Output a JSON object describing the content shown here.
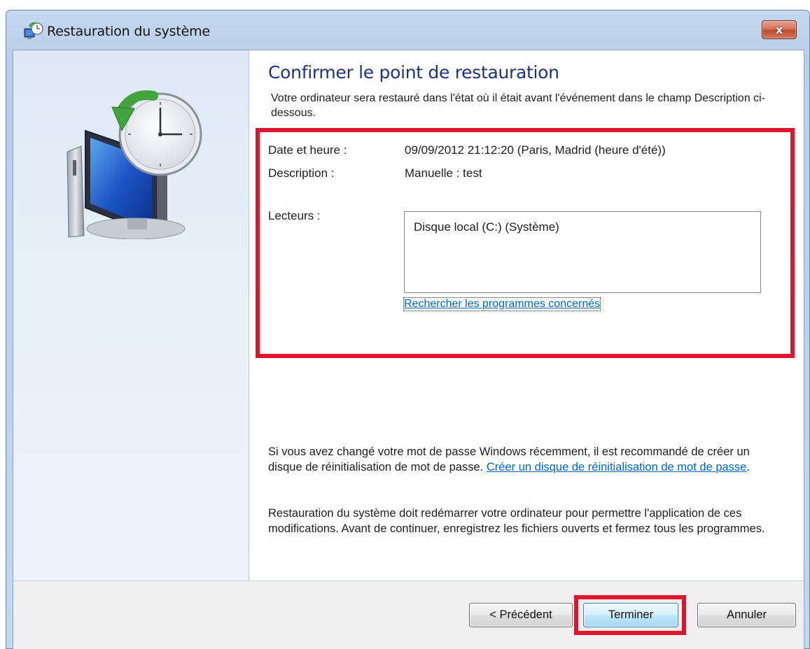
{
  "window": {
    "title": "Restauration du système",
    "close_label": "x"
  },
  "main": {
    "heading": "Confirmer le point de restauration",
    "intro": "Votre ordinateur sera restauré dans l'état où il était avant l'événement dans le champ Description ci-dessous.",
    "date_label": "Date et heure :",
    "date_value": "09/09/2012 21:12:20 (Paris, Madrid (heure d'été))",
    "description_label": "Description :",
    "description_value": "Manuelle : test",
    "drives_label": "Lecteurs :",
    "drives": [
      "Disque local (C:) (Système)"
    ],
    "scan_link": "Rechercher les programmes concernés",
    "password_text": "Si vous avez changé votre mot de passe Windows récemment, il est recommandé de créer un disque de réinitialisation de mot de passe.",
    "password_link": "Créer un disque de réinitialisation de mot de passe",
    "password_end": ".",
    "restart_text": "Restauration du système doit redémarrer votre ordinateur pour permettre l'application de ces modifications. Avant de continuer, enregistrez les fichiers ouverts et fermez tous les programmes."
  },
  "footer": {
    "back_label": "< Précédent",
    "finish_label": "Terminer",
    "cancel_label": "Annuler"
  },
  "colors": {
    "highlight": "#e0152b",
    "heading": "#1e3287",
    "link": "#0066cc"
  },
  "icons": {
    "title_icon": "system-restore-icon",
    "illustration": "computer-clock-restore-icon"
  }
}
